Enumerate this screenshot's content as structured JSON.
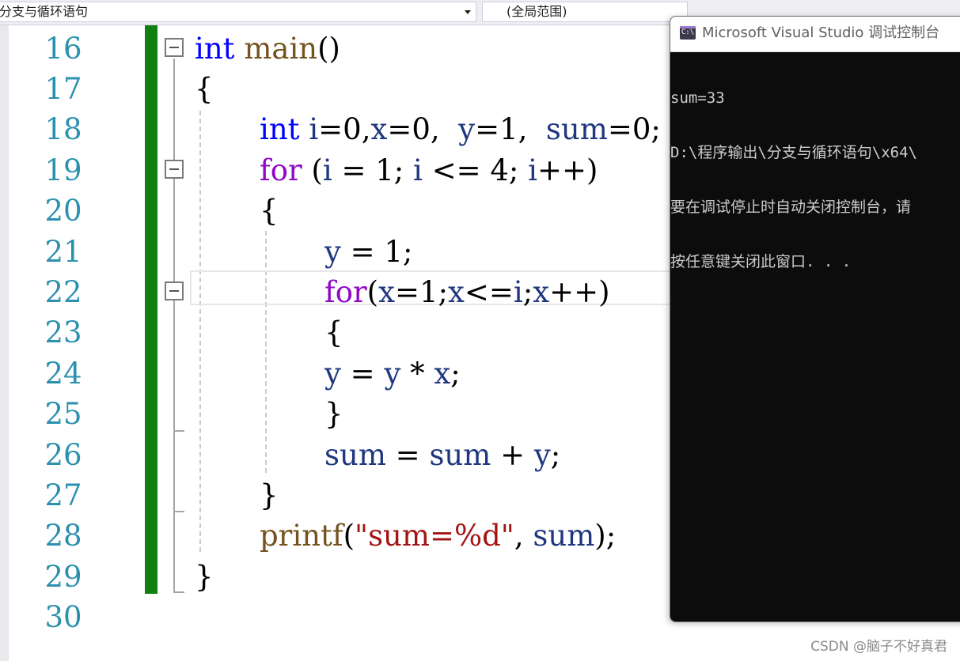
{
  "navbar": {
    "scope_left": "分支与循环语句",
    "scope_right": "(全局范围)"
  },
  "editor": {
    "line_numbers": [
      "16",
      "17",
      "18",
      "19",
      "20",
      "21",
      "22",
      "23",
      "24",
      "25",
      "26",
      "27",
      "28",
      "29",
      "30"
    ],
    "lines": {
      "l16": {
        "kw": "int",
        "sp": " ",
        "fn": "main",
        "punc": "()"
      },
      "l17": {
        "punc": "{"
      },
      "l18": {
        "kw": "int",
        "a": " ",
        "v1": "i",
        "b": "=0,",
        "v2": "x",
        "c": "=0,  ",
        "v3": "y",
        "d": "=1,  ",
        "v4": "sum",
        "e": "=0;"
      },
      "l19": {
        "ctl": "for",
        "a": " (",
        "v1": "i",
        "b": " = 1; ",
        "v2": "i",
        "c": " <= 4; ",
        "v3": "i",
        "d": "++)"
      },
      "l20": {
        "punc": "{"
      },
      "l21": {
        "v1": "y",
        "a": " = 1;"
      },
      "l22": {
        "ctl": "for",
        "a": "(",
        "v1": "x",
        "b": "=1;",
        "v2": "x",
        "c": "<=",
        "v3": "i",
        "d": ";",
        "v4": "x",
        "e": "++)"
      },
      "l23": {
        "punc": "{"
      },
      "l24": {
        "v1": "y",
        "a": " = ",
        "v2": "y",
        "b": " * ",
        "v3": "x",
        "c": ";"
      },
      "l25": {
        "punc": "}"
      },
      "l26": {
        "v1": "sum",
        "a": " = ",
        "v2": "sum",
        "b": " + ",
        "v3": "y",
        "c": ";"
      },
      "l27": {
        "punc": "}"
      },
      "l28": {
        "fn": "printf",
        "a": "(",
        "str": "\"sum=%d\"",
        "b": ", ",
        "v1": "sum",
        "c": ");"
      },
      "l29": {
        "punc": "}"
      }
    }
  },
  "console": {
    "title": "Microsoft Visual Studio 调试控制台",
    "icon_text": "C:\\",
    "lines": [
      "sum=33",
      "D:\\程序输出\\分支与循环语句\\x64\\",
      "要在调试停止时自动关闭控制台，请",
      "按任意键关闭此窗口. . ."
    ]
  },
  "watermark": "CSDN @脑子不好真君",
  "colors": {
    "keyword": "#0000ff",
    "control": "#8f08c4",
    "variable": "#1f377f",
    "function": "#74531f",
    "string": "#a31515",
    "line_number": "#2b91af",
    "change_bar": "#108010"
  }
}
